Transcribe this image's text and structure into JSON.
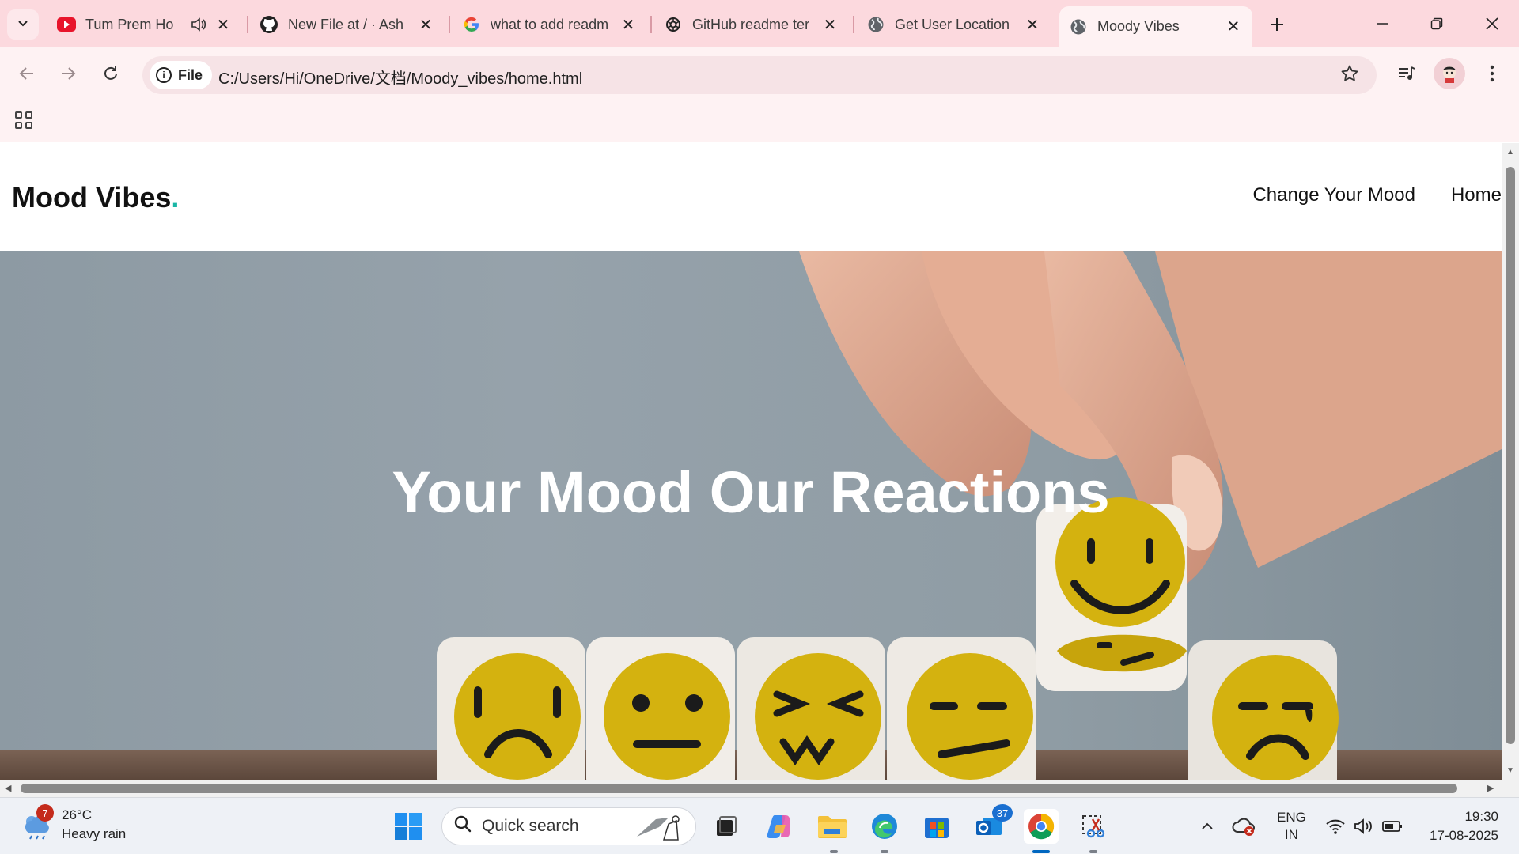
{
  "browser": {
    "tabs": [
      {
        "title": "Tum Prem Ho",
        "favicon": "youtube-icon",
        "audio": true
      },
      {
        "title": "New File at / · Ash",
        "favicon": "github-icon"
      },
      {
        "title": "what to add readm",
        "favicon": "google-icon"
      },
      {
        "title": "GitHub readme ter",
        "favicon": "openai-icon"
      },
      {
        "title": "Get User Location",
        "favicon": "globe-icon"
      },
      {
        "title": "Moody Vibes",
        "favicon": "globe-icon",
        "active": true
      }
    ],
    "address": {
      "scheme_chip": "File",
      "url": "C:/Users/Hi/OneDrive/文档/Moody_vibes/home.html"
    }
  },
  "page": {
    "brand": "Mood Vibes",
    "brand_dot": ".",
    "nav": [
      "Change Your Mood",
      "Home"
    ],
    "hero_title": "Your Mood Our Reactions"
  },
  "taskbar": {
    "weather": {
      "temp": "26°C",
      "desc": "Heavy rain",
      "badge": "7"
    },
    "search_placeholder": "Quick search",
    "outlook_badge": "37",
    "lang_top": "ENG",
    "lang_bottom": "IN",
    "time": "19:30",
    "date": "17-08-2025"
  },
  "colors": {
    "tabstrip": "#fcd9de",
    "accent_dot": "#19b6a5",
    "hero_bg": "#8d9aa3",
    "emoji_yellow": "#d4b20f"
  }
}
